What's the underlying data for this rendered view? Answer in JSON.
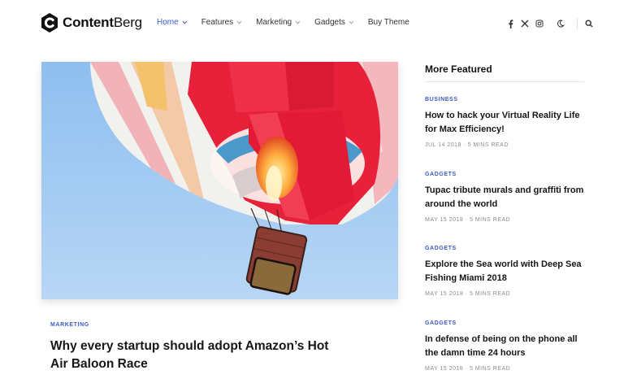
{
  "logo": {
    "bold": "Content",
    "light": "Berg"
  },
  "nav": [
    {
      "label": "Home",
      "active": true,
      "dropdown": true
    },
    {
      "label": "Features",
      "active": false,
      "dropdown": true
    },
    {
      "label": "Marketing",
      "active": false,
      "dropdown": true
    },
    {
      "label": "Gadgets",
      "active": false,
      "dropdown": true
    },
    {
      "label": "Buy Theme",
      "active": false,
      "dropdown": false
    }
  ],
  "header_icons": [
    "facebook-icon",
    "x-icon",
    "instagram-icon",
    "moon-icon",
    "search-icon"
  ],
  "main": {
    "category": "MARKETING",
    "title": "Why every startup should adopt Amazon’s Hot Air Baloon Race"
  },
  "sidebar": {
    "heading": "More Featured",
    "posts": [
      {
        "category": "BUSINESS",
        "title": "How to hack your Virtual Reality Life for Max Efficiency!",
        "meta": "JUL 14 2018 · 5 MINS READ"
      },
      {
        "category": "GADGETS",
        "title": "Tupac tribute murals and graffiti from around the world",
        "meta": "MAY 15 2018 · 5 MINS READ"
      },
      {
        "category": "GADGETS",
        "title": "Explore the Sea world with Deep Sea Fishing Miami 2018",
        "meta": "MAY 15 2018 · 5 MINS READ"
      },
      {
        "category": "GADGETS",
        "title": "In defense of being on the phone all the damn time 24 hours",
        "meta": "MAY 15 2018 · 5 MINS READ"
      }
    ]
  },
  "colors": {
    "accent": "#3a5ac9",
    "text": "#161616",
    "meta": "#8a8a8a"
  }
}
